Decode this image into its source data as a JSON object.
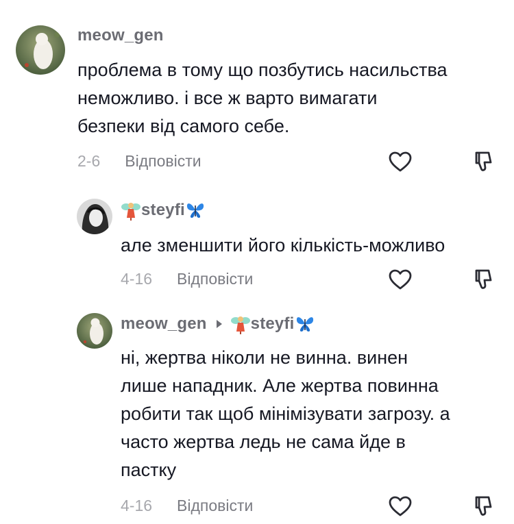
{
  "comments": [
    {
      "username": "meow_gen",
      "text": "проблема в тому що позбутись насильства\nнеможливо. і все ж варто вимагати\nбезпеки від самого себе.",
      "date": "2-6",
      "reply_label": "Відповісти"
    },
    {
      "username": "steyfi",
      "text": "але зменшити його кількість-можливо",
      "date": "4-16",
      "reply_label": "Відповісти"
    },
    {
      "username": "meow_gen",
      "reply_to": "steyfi",
      "text": "ні, жертва ніколи не винна. винен\nлише нападник. Але жертва повинна\nробити так щоб мінімізувати загрозу. а\nчасто жертва ледь не сама йде в\nпастку",
      "date": "4-16",
      "reply_label": "Відповісти"
    }
  ],
  "icons": {
    "like": "heart-outline",
    "dislike": "thumbs-down-outline"
  },
  "colors": {
    "text": "#161823",
    "username": "#6b6c73",
    "meta": "#a7a8ad"
  }
}
